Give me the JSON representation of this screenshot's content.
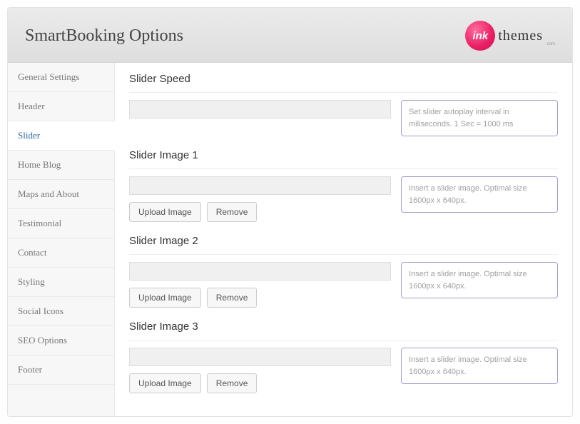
{
  "header": {
    "title": "SmartBooking Options",
    "logo_ink": "ink",
    "logo_themes": "themes",
    "logo_sub": ".com"
  },
  "sidebar": {
    "items": [
      {
        "label": "General Settings",
        "active": false
      },
      {
        "label": "Header",
        "active": false
      },
      {
        "label": "Slider",
        "active": true
      },
      {
        "label": "Home Blog",
        "active": false
      },
      {
        "label": "Maps and About",
        "active": false
      },
      {
        "label": "Testimonial",
        "active": false
      },
      {
        "label": "Contact",
        "active": false
      },
      {
        "label": "Styling",
        "active": false
      },
      {
        "label": "Social Icons",
        "active": false
      },
      {
        "label": "SEO Options",
        "active": false
      },
      {
        "label": "Footer",
        "active": false
      }
    ]
  },
  "sections": [
    {
      "label": "Slider Speed",
      "value": "",
      "help": "Set slider autoplay interval in miliseconds. 1 Sec = 1000 ms",
      "buttons": []
    },
    {
      "label": "Slider Image 1",
      "value": "",
      "help": "Insert a slider image. Optimal size 1600px x 640px.",
      "buttons": [
        "Upload Image",
        "Remove"
      ]
    },
    {
      "label": "Slider Image 2",
      "value": "",
      "help": "Insert a slider image. Optimal size 1600px x 640px.",
      "buttons": [
        "Upload Image",
        "Remove"
      ]
    },
    {
      "label": "Slider Image 3",
      "value": "",
      "help": "Insert a slider image. Optimal size 1600px x 640px.",
      "buttons": [
        "Upload Image",
        "Remove"
      ]
    }
  ]
}
